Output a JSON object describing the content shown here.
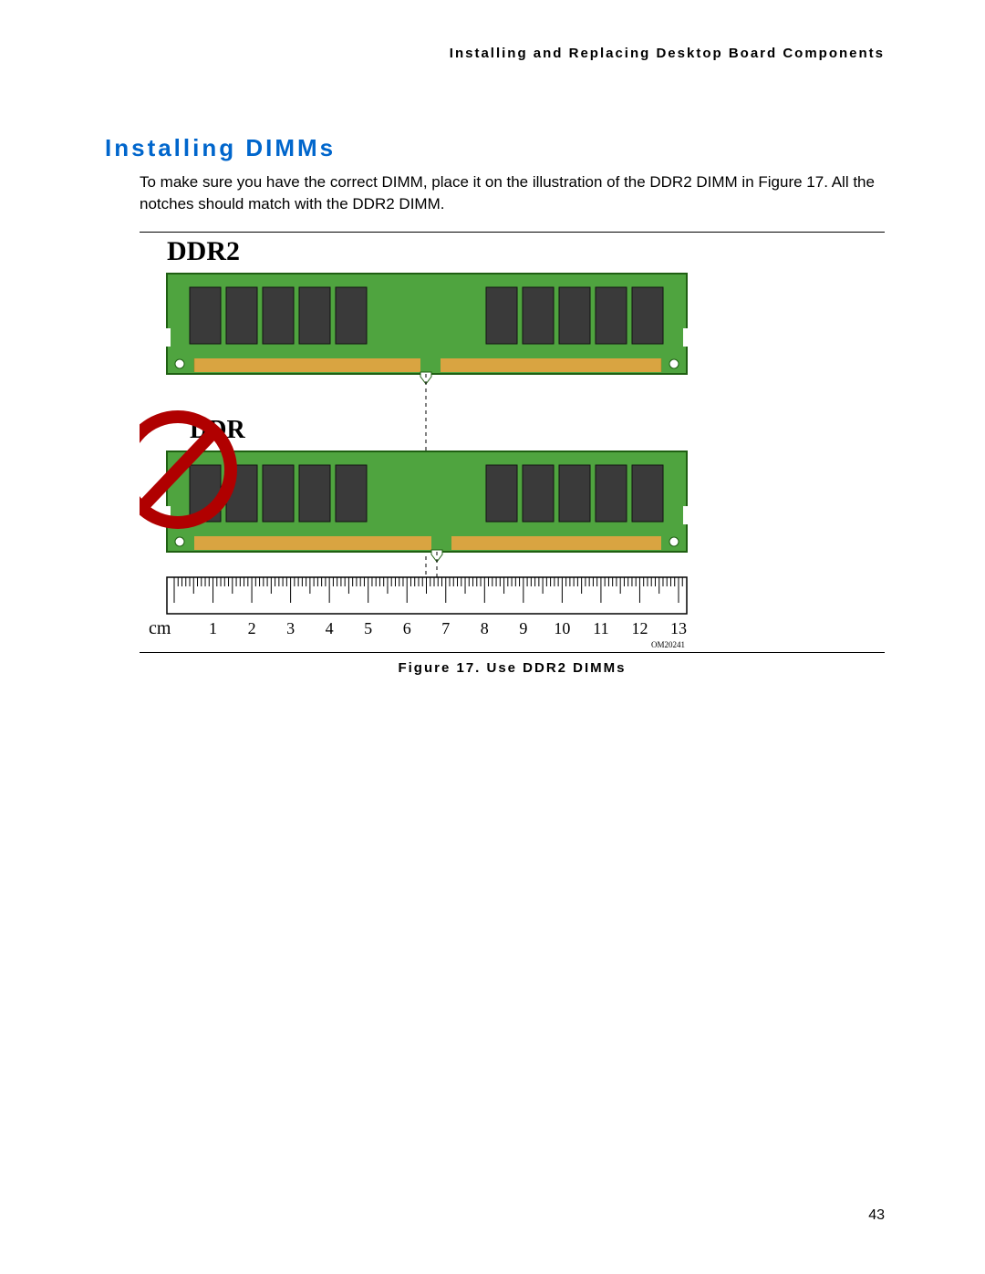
{
  "header": "Installing and Replacing Desktop Board Components",
  "title": "Installing DIMMs",
  "paragraph": "To make sure you have the correct DIMM, place it on the illustration of the DDR2 DIMM in Figure 17.  All the notches should match with the DDR2 DIMM.",
  "figure": {
    "caption": "Figure 17. Use DDR2 DIMMs",
    "ddr2_label": "DDR2",
    "ddr_label": "DDR",
    "ruler_unit": "cm",
    "ruler_marks": [
      "1",
      "2",
      "3",
      "4",
      "5",
      "6",
      "7",
      "8",
      "9",
      "10",
      "11",
      "12",
      "13"
    ],
    "om_code": "OM20241"
  },
  "page_number": "43"
}
